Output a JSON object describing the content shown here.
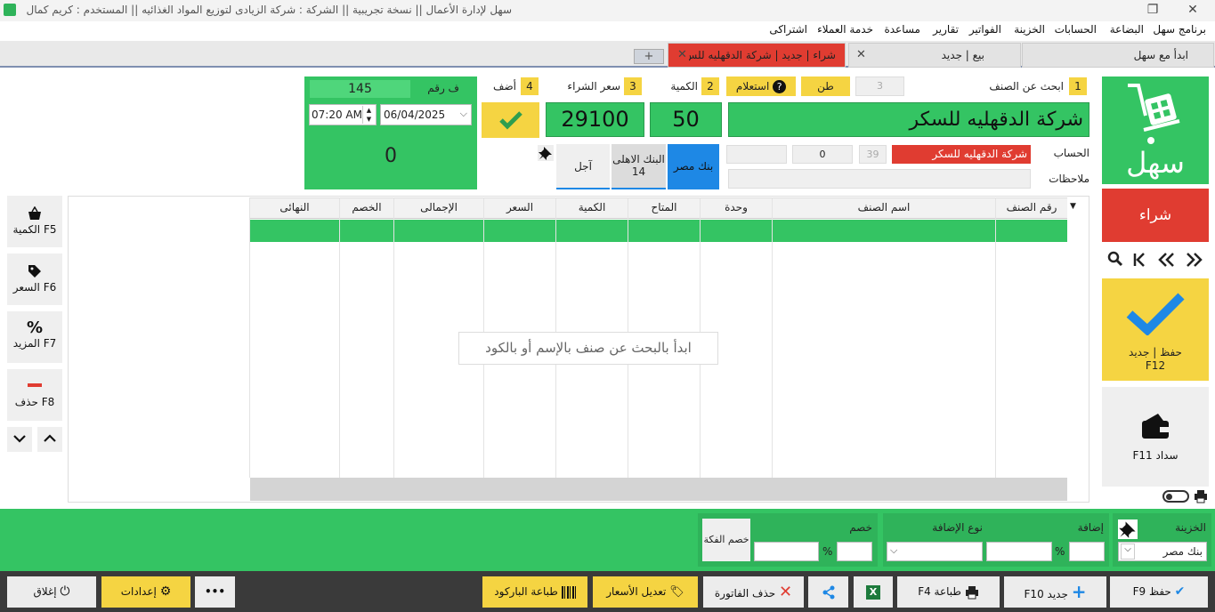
{
  "titlebar": {
    "title": "سهل لإدارة الأعمال   ||   نسخة تجريبية   ||   الشركة : شركة الزيادى لتوزيع المواد الغذائيه   ||   المستخدم : كريم كمال",
    "close": "✕",
    "restore": "❐"
  },
  "menu": [
    "برنامج سهل",
    "البضاعة",
    "الحسابات",
    "الخزينة",
    "الفواتير",
    "تقارير",
    "مساعدة",
    "خدمة العملاء",
    "اشتراكى"
  ],
  "tabs": {
    "home": "ابدأ مع سهل",
    "sell": "بيع | جديد",
    "buy": "شراء | جديد | شركة الدقهليه للس",
    "close": "✕",
    "add": "+"
  },
  "form": {
    "step1": "1",
    "step1_label": "ابحث عن الصنف",
    "step2": "2",
    "step2_label": "الكمية",
    "step3": "3",
    "step3_label": "سعر الشراء",
    "step4": "4",
    "step4_label": "أضف",
    "unit_count": "3",
    "unit": "طن",
    "inquiry": "استعلام",
    "item_name": "شركة الدقهليه للسكر",
    "quantity": "50",
    "price": "29100",
    "invoice_label": "ف رقم",
    "invoice_no": "145",
    "time": "07:20 AM",
    "date": "06/04/2025",
    "total": "0",
    "account_label": "الحساب",
    "account_code": "39",
    "account_name": "شركة الدقهليه للسكر",
    "account_balance": "0",
    "notes_label": "ملاحظات",
    "pay_cash_bank": "بنك مصر",
    "pay_bank2": "البنك الاهلى",
    "pay_bank2_no": "14",
    "pay_credit": "آجل"
  },
  "sidebar": {
    "logo_text": "سهل",
    "mode": "شراء",
    "save_new": "حفظ | جديد",
    "save_new_key": "F12",
    "payment": "سداد F11"
  },
  "tools": {
    "qty": "الكمية F5",
    "price": "السعر F6",
    "more": "المزيد F7",
    "more_icon": "%",
    "delete": "حذف F8"
  },
  "grid": {
    "columns": [
      "رقم الصنف",
      "اسم الصنف",
      "وحدة",
      "المتاح",
      "الكمية",
      "السعر",
      "الإجمالى",
      "الخصم",
      "النهائى"
    ],
    "placeholder": "ابدأ بالبحث عن صنف بالإسم أو بالكود"
  },
  "totals": {
    "treasury_label": "الخزينة",
    "treasury_value": "بنك مصر",
    "addition_label": "إضافة",
    "addition_type_label": "نوع الإضافة",
    "discount_label": "خصم",
    "cash_discount": "خصم الفكة",
    "pct": "%"
  },
  "footer": {
    "save": "حفظ F9",
    "new": "جديد F10",
    "print": "طباعة F4",
    "delete_invoice": "حذف الفاتورة",
    "edit_prices": "تعديل الأسعار",
    "print_barcode": "طباعة الباركود",
    "more": "•••",
    "settings": "إعدادات",
    "close": "إغلاق"
  },
  "colors": {
    "green": "#34c463",
    "yellow": "#f5d442",
    "red": "#e03c31",
    "dark": "#3a3a3a",
    "blue": "#1e88e5"
  }
}
